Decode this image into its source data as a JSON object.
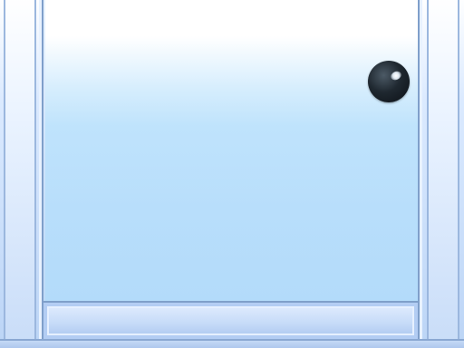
{
  "game": {
    "colors": {
      "wall_light": "#ffffff",
      "wall_mid": "#dbeaff",
      "wall_border": "#7f9fca",
      "field_top": "#ffffff",
      "field_bottom": "#b3dbfa",
      "floor": "#c6dbf8",
      "ball": "#1f2830",
      "ball_highlight": "#ffffff"
    },
    "icons": {
      "ball": "ball-icon"
    }
  }
}
